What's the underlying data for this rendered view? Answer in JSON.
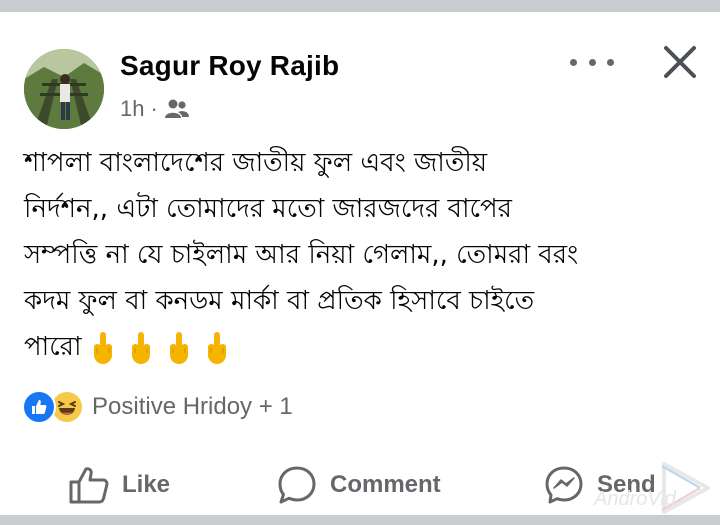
{
  "post": {
    "author": "Sagur Roy Rajib",
    "time": "1h",
    "separator": "·",
    "audience_icon": "friends-icon",
    "text_lines": [
      "শাপলা বাংলাদেশের জাতীয় ফুল এবং জাতীয়",
      "নির্দশন,, এটা তোমাদের মতো জারজদের বাপের",
      "সম্পত্তি না যে চাইলাম আর নিয়া গেলাম,, তোমরা বরং",
      "কদম ফুল বা কনডম মার্কা বা প্রতিক হিসাবে চাইতে",
      "পারো"
    ],
    "emoji_icon": "middle-finger-emoji",
    "emoji_count": 4
  },
  "reactions": {
    "icons": [
      "like-icon",
      "haha-icon"
    ],
    "summary": "Positive Hridoy + 1"
  },
  "actions": {
    "like": "Like",
    "comment": "Comment",
    "send": "Send"
  },
  "watermark": {
    "text": "AndroVid"
  },
  "colors": {
    "background": "#c9ccd1",
    "card": "#ffffff",
    "text": "#050505",
    "secondary": "#65676b",
    "like_blue": "#1877f2",
    "haha_yellow": "#f7c948"
  }
}
